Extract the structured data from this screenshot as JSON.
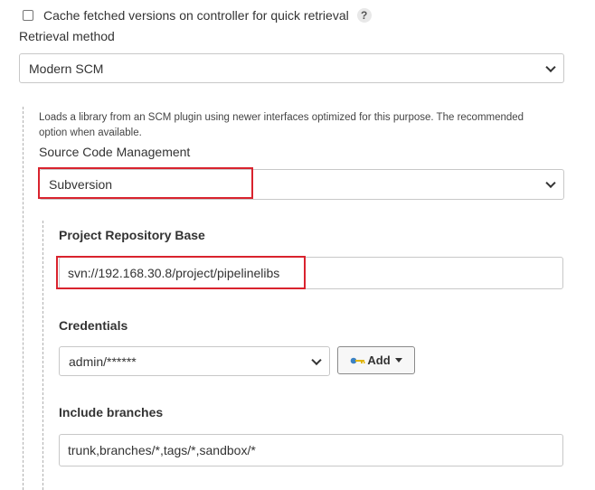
{
  "cache": {
    "label": "Cache fetched versions on controller for quick retrieval",
    "checked": false,
    "help": "?"
  },
  "retrieval": {
    "label": "Retrieval method",
    "value": "Modern SCM"
  },
  "description": "Loads a library from an SCM plugin using newer interfaces optimized for this purpose. The recommended option when available.",
  "scm": {
    "label": "Source Code Management",
    "value": "Subversion"
  },
  "repo": {
    "label": "Project Repository Base",
    "value": "svn://192.168.30.8/project/pipelinelibs"
  },
  "credentials": {
    "label": "Credentials",
    "value": "admin/******",
    "add_label": "Add"
  },
  "branches": {
    "label": "Include branches",
    "value": "trunk,branches/*,tags/*,sandbox/*"
  },
  "colors": {
    "highlight": "#d9232e",
    "key_icon": "#3b82c4"
  }
}
